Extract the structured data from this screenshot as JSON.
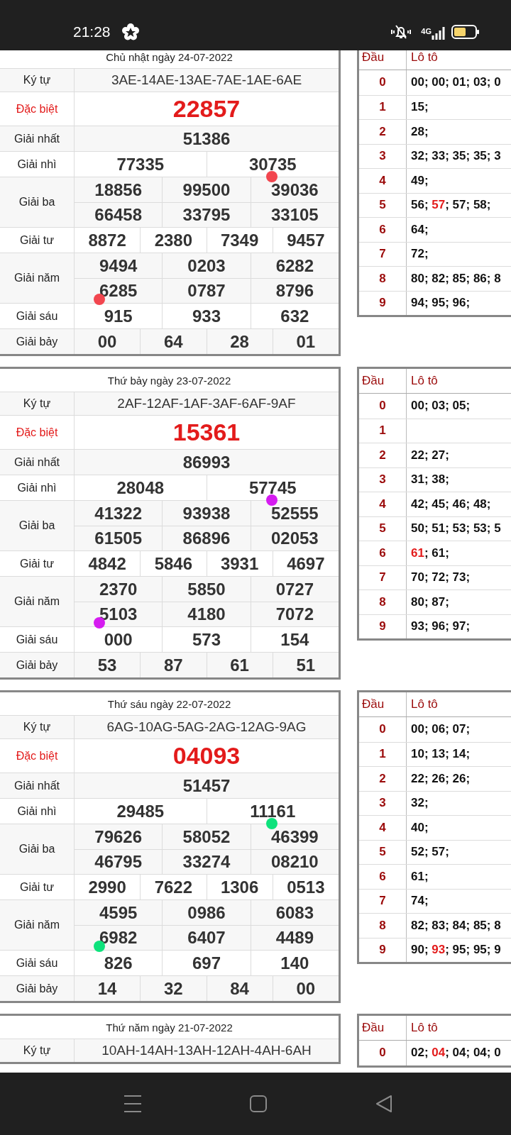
{
  "status_bar": {
    "time": "21:28",
    "network": "4G"
  },
  "blocks": [
    {
      "title": "Chủ nhật ngày 24-07-2022",
      "code": {
        "label": "Ký tự",
        "value": "3AE-14AE-13AE-7AE-1AE-6AE"
      },
      "markers": [
        {
          "color": "#f2464f"
        },
        {
          "color": "#f2464f"
        }
      ],
      "prizes": [
        {
          "label": "Đặc biệt",
          "kind": "special",
          "lines": [
            [
              "22857"
            ]
          ]
        },
        {
          "label": "Giải nhất",
          "kind": "normal",
          "lines": [
            [
              "51386"
            ]
          ]
        },
        {
          "label": "Giải nhì",
          "kind": "normal",
          "lines": [
            [
              "77335",
              "30735"
            ]
          ]
        },
        {
          "label": "Giải ba",
          "kind": "normal",
          "lines": [
            [
              "18856",
              "99500",
              "39036"
            ],
            [
              "66458",
              "33795",
              "33105"
            ]
          ]
        },
        {
          "label": "Giải tư",
          "kind": "normal",
          "lines": [
            [
              "8872",
              "2380",
              "7349",
              "9457"
            ]
          ]
        },
        {
          "label": "Giải năm",
          "kind": "normal",
          "lines": [
            [
              "9494",
              "0203",
              "6282"
            ],
            [
              "6285",
              "0787",
              "8796"
            ]
          ]
        },
        {
          "label": "Giải sáu",
          "kind": "normal",
          "lines": [
            [
              "915",
              "933",
              "632"
            ]
          ]
        },
        {
          "label": "Giải bảy",
          "kind": "normal",
          "lines": [
            [
              "00",
              "64",
              "28",
              "01"
            ]
          ]
        }
      ],
      "loto": {
        "columns": [
          "Đầu",
          "Lô tô"
        ],
        "rows": [
          {
            "head": "0",
            "parts": [
              {
                "text": "00; 00; 01; 03; 0",
                "highlighted": false
              }
            ]
          },
          {
            "head": "1",
            "parts": [
              {
                "text": "15;",
                "highlighted": false
              }
            ]
          },
          {
            "head": "2",
            "parts": [
              {
                "text": "28;",
                "highlighted": false
              }
            ]
          },
          {
            "head": "3",
            "parts": [
              {
                "text": "32; 33; 35; 35; 3",
                "highlighted": false
              }
            ]
          },
          {
            "head": "4",
            "parts": [
              {
                "text": "49;",
                "highlighted": false
              }
            ]
          },
          {
            "head": "5",
            "parts": [
              {
                "text": "56; ",
                "highlighted": false
              },
              {
                "text": "57",
                "highlighted": true
              },
              {
                "text": "; 57; 58;",
                "highlighted": false
              }
            ]
          },
          {
            "head": "6",
            "parts": [
              {
                "text": "64;",
                "highlighted": false
              }
            ]
          },
          {
            "head": "7",
            "parts": [
              {
                "text": "72;",
                "highlighted": false
              }
            ]
          },
          {
            "head": "8",
            "parts": [
              {
                "text": "80; 82; 85; 86; 8",
                "highlighted": false
              }
            ]
          },
          {
            "head": "9",
            "parts": [
              {
                "text": "94; 95; 96;",
                "highlighted": false
              }
            ]
          }
        ]
      }
    },
    {
      "title": "Thứ bảy ngày 23-07-2022",
      "code": {
        "label": "Ký tự",
        "value": "2AF-12AF-1AF-3AF-6AF-9AF"
      },
      "markers": [
        {
          "color": "#d51cf0"
        },
        {
          "color": "#d51cf0"
        }
      ],
      "prizes": [
        {
          "label": "Đặc biệt",
          "kind": "special",
          "lines": [
            [
              "15361"
            ]
          ]
        },
        {
          "label": "Giải nhất",
          "kind": "normal",
          "lines": [
            [
              "86993"
            ]
          ]
        },
        {
          "label": "Giải nhì",
          "kind": "normal",
          "lines": [
            [
              "28048",
              "57745"
            ]
          ]
        },
        {
          "label": "Giải ba",
          "kind": "normal",
          "lines": [
            [
              "41322",
              "93938",
              "52555"
            ],
            [
              "61505",
              "86896",
              "02053"
            ]
          ]
        },
        {
          "label": "Giải tư",
          "kind": "normal",
          "lines": [
            [
              "4842",
              "5846",
              "3931",
              "4697"
            ]
          ]
        },
        {
          "label": "Giải năm",
          "kind": "normal",
          "lines": [
            [
              "2370",
              "5850",
              "0727"
            ],
            [
              "5103",
              "4180",
              "7072"
            ]
          ]
        },
        {
          "label": "Giải sáu",
          "kind": "normal",
          "lines": [
            [
              "000",
              "573",
              "154"
            ]
          ]
        },
        {
          "label": "Giải bảy",
          "kind": "normal",
          "lines": [
            [
              "53",
              "87",
              "61",
              "51"
            ]
          ]
        }
      ],
      "loto": {
        "columns": [
          "Đầu",
          "Lô tô"
        ],
        "rows": [
          {
            "head": "0",
            "parts": [
              {
                "text": "00; 03; 05;",
                "highlighted": false
              }
            ]
          },
          {
            "head": "1",
            "parts": []
          },
          {
            "head": "2",
            "parts": [
              {
                "text": "22; 27;",
                "highlighted": false
              }
            ]
          },
          {
            "head": "3",
            "parts": [
              {
                "text": "31; 38;",
                "highlighted": false
              }
            ]
          },
          {
            "head": "4",
            "parts": [
              {
                "text": "42; 45; 46; 48;",
                "highlighted": false
              }
            ]
          },
          {
            "head": "5",
            "parts": [
              {
                "text": "50; 51; 53; 53; 5",
                "highlighted": false
              }
            ]
          },
          {
            "head": "6",
            "parts": [
              {
                "text": "61",
                "highlighted": true
              },
              {
                "text": "; 61;",
                "highlighted": false
              }
            ]
          },
          {
            "head": "7",
            "parts": [
              {
                "text": "70; 72; 73;",
                "highlighted": false
              }
            ]
          },
          {
            "head": "8",
            "parts": [
              {
                "text": "80; 87;",
                "highlighted": false
              }
            ]
          },
          {
            "head": "9",
            "parts": [
              {
                "text": "93; 96; 97;",
                "highlighted": false
              }
            ]
          }
        ]
      }
    },
    {
      "title": "Thứ sáu ngày 22-07-2022",
      "code": {
        "label": "Ký tự",
        "value": "6AG-10AG-5AG-2AG-12AG-9AG"
      },
      "markers": [
        {
          "color": "#0ee27c"
        },
        {
          "color": "#0ee27c"
        }
      ],
      "prizes": [
        {
          "label": "Đặc biệt",
          "kind": "special",
          "lines": [
            [
              "04093"
            ]
          ]
        },
        {
          "label": "Giải nhất",
          "kind": "normal",
          "lines": [
            [
              "51457"
            ]
          ]
        },
        {
          "label": "Giải nhì",
          "kind": "normal",
          "lines": [
            [
              "29485",
              "11161"
            ]
          ]
        },
        {
          "label": "Giải ba",
          "kind": "normal",
          "lines": [
            [
              "79626",
              "58052",
              "46399"
            ],
            [
              "46795",
              "33274",
              "08210"
            ]
          ]
        },
        {
          "label": "Giải tư",
          "kind": "normal",
          "lines": [
            [
              "2990",
              "7622",
              "1306",
              "0513"
            ]
          ]
        },
        {
          "label": "Giải năm",
          "kind": "normal",
          "lines": [
            [
              "4595",
              "0986",
              "6083"
            ],
            [
              "6982",
              "6407",
              "4489"
            ]
          ]
        },
        {
          "label": "Giải sáu",
          "kind": "normal",
          "lines": [
            [
              "826",
              "697",
              "140"
            ]
          ]
        },
        {
          "label": "Giải bảy",
          "kind": "normal",
          "lines": [
            [
              "14",
              "32",
              "84",
              "00"
            ]
          ]
        }
      ],
      "loto": {
        "columns": [
          "Đầu",
          "Lô tô"
        ],
        "rows": [
          {
            "head": "0",
            "parts": [
              {
                "text": "00; 06; 07;",
                "highlighted": false
              }
            ]
          },
          {
            "head": "1",
            "parts": [
              {
                "text": "10; 13; 14;",
                "highlighted": false
              }
            ]
          },
          {
            "head": "2",
            "parts": [
              {
                "text": "22; 26; 26;",
                "highlighted": false
              }
            ]
          },
          {
            "head": "3",
            "parts": [
              {
                "text": "32;",
                "highlighted": false
              }
            ]
          },
          {
            "head": "4",
            "parts": [
              {
                "text": "40;",
                "highlighted": false
              }
            ]
          },
          {
            "head": "5",
            "parts": [
              {
                "text": "52; 57;",
                "highlighted": false
              }
            ]
          },
          {
            "head": "6",
            "parts": [
              {
                "text": "61;",
                "highlighted": false
              }
            ]
          },
          {
            "head": "7",
            "parts": [
              {
                "text": "74;",
                "highlighted": false
              }
            ]
          },
          {
            "head": "8",
            "parts": [
              {
                "text": "82; 83; 84; 85; 8",
                "highlighted": false
              }
            ]
          },
          {
            "head": "9",
            "parts": [
              {
                "text": "90; ",
                "highlighted": false
              },
              {
                "text": "93",
                "highlighted": true
              },
              {
                "text": "; 95; 95; 9",
                "highlighted": false
              }
            ]
          }
        ]
      }
    },
    {
      "title": "Thứ năm ngày 21-07-2022",
      "code": {
        "label": "Ký tự",
        "value": "10AH-14AH-13AH-12AH-4AH-6AH"
      },
      "loto": {
        "columns": [
          "Đầu",
          "Lô tô"
        ],
        "rows": [
          {
            "head": "0",
            "parts": [
              {
                "text": "02; ",
                "highlighted": false
              },
              {
                "text": "04",
                "highlighted": true
              },
              {
                "text": "; 04; 04; 0",
                "highlighted": false
              }
            ]
          }
        ]
      }
    }
  ]
}
